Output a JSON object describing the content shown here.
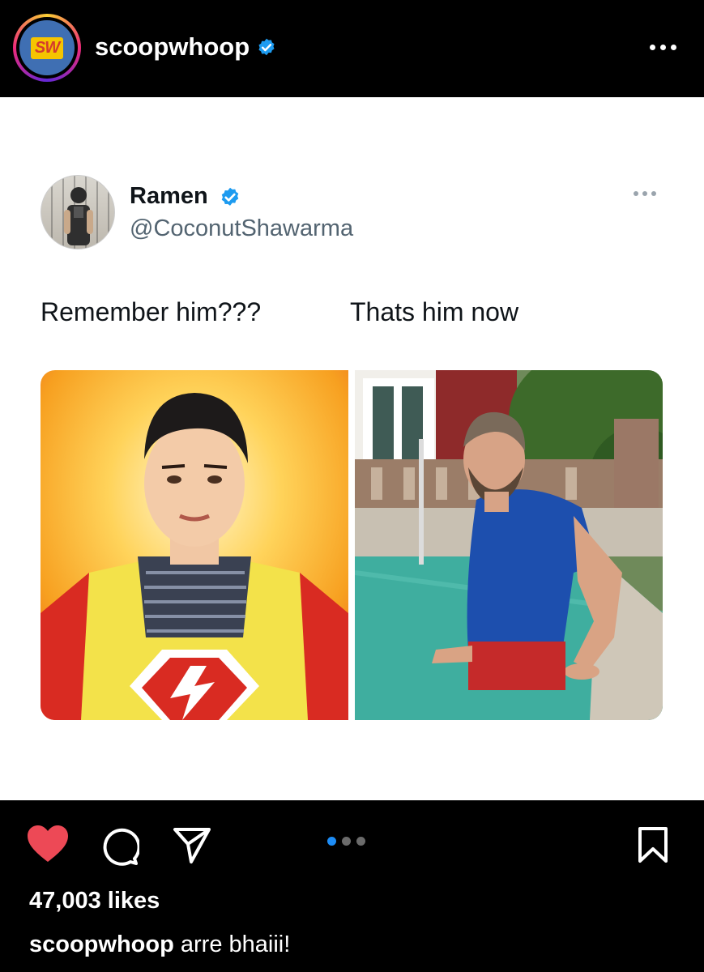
{
  "post_header": {
    "avatar_text": "SW",
    "username": "scoopwhoop",
    "verified_icon": "verified-badge-icon",
    "more_icon": "more-options-icon"
  },
  "tweet": {
    "author_name": "Ramen",
    "author_handle": "@CoconutShawarma",
    "text_left": "Remember him???",
    "text_right": "Thats him now",
    "images": [
      {
        "description_icon": "superhero-photo"
      },
      {
        "description_icon": "pool-photo"
      }
    ]
  },
  "actions": {
    "like_icon": "heart-filled-icon",
    "comment_icon": "comment-icon",
    "share_icon": "send-icon",
    "save_icon": "bookmark-icon",
    "carousel_count": 3,
    "carousel_active": 1
  },
  "likes": "47,003 likes",
  "caption": {
    "username": "scoopwhoop",
    "text": " arre bhaiii!"
  },
  "colors": {
    "like": "#ed4956",
    "verified": "#1d9bf0",
    "carousel_active": "#1d8cf5"
  }
}
